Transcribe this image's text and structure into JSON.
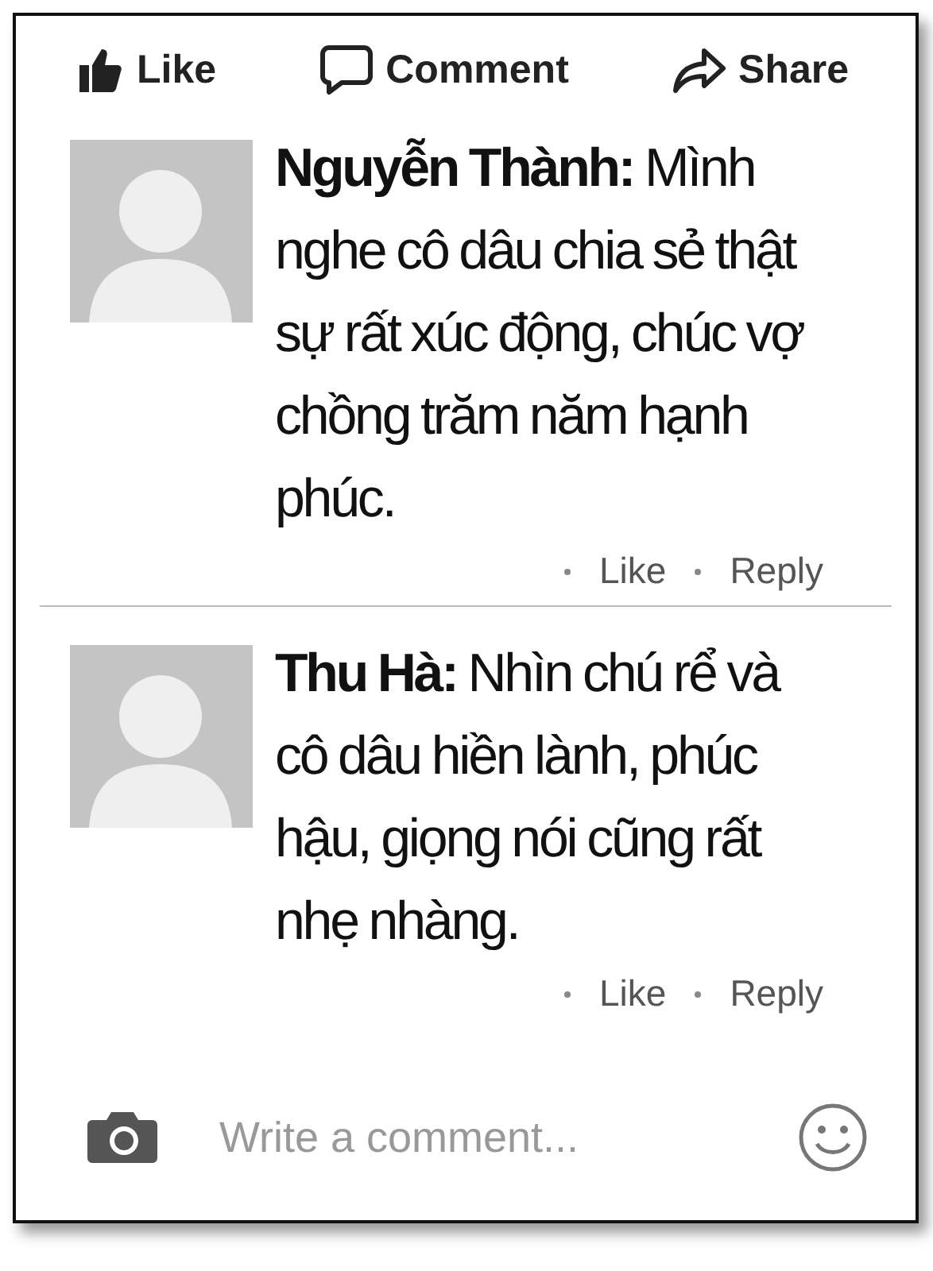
{
  "actions": [
    {
      "kind": "like",
      "label": "Like"
    },
    {
      "kind": "comment",
      "label": "Comment"
    },
    {
      "kind": "share",
      "label": "Share"
    }
  ],
  "comments": [
    {
      "author": "Nguyễn Thành:",
      "text": "Mình nghe cô dâu chia sẻ thật sự rất xúc động, chúc vợ chồng trăm năm hạnh phúc.",
      "links": [
        "Like",
        "Reply"
      ]
    },
    {
      "author": "Thu Hà:",
      "text": "Nhìn chú rể và cô dâu hiền lành, phúc hậu, giọng nói cũng rất nhẹ nhàng.",
      "links": [
        "Like",
        "Reply"
      ]
    }
  ],
  "composer": {
    "placeholder": "Write a comment..."
  }
}
